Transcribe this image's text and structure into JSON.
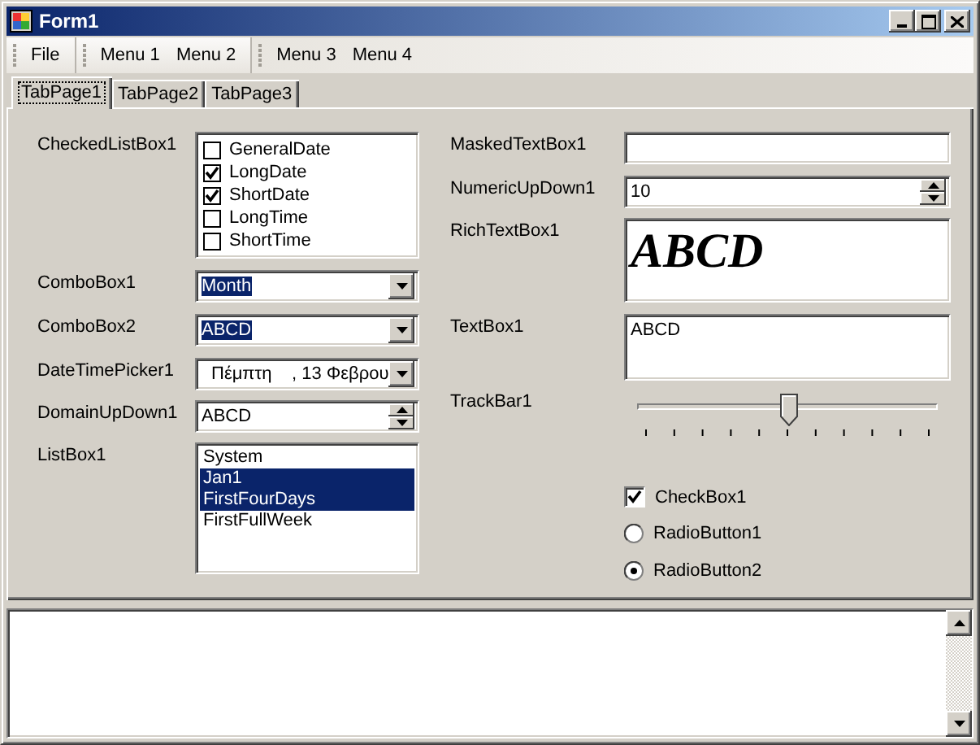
{
  "window": {
    "title": "Form1"
  },
  "menu_groups": [
    {
      "items": [
        "File"
      ]
    },
    {
      "items": [
        "Menu 1",
        "Menu 2"
      ]
    },
    {
      "items": [
        "Menu 3",
        "Menu 4"
      ]
    }
  ],
  "tabs": [
    {
      "label": "TabPage1",
      "selected": true
    },
    {
      "label": "TabPage2",
      "selected": false
    },
    {
      "label": "TabPage3",
      "selected": false
    }
  ],
  "left": [
    {
      "kind": "checkedlist",
      "label": "CheckedListBox1",
      "items": [
        {
          "text": "GeneralDate",
          "checked": false
        },
        {
          "text": "LongDate",
          "checked": true
        },
        {
          "text": "ShortDate",
          "checked": true
        },
        {
          "text": "LongTime",
          "checked": false
        },
        {
          "text": "ShortTime",
          "checked": false
        }
      ]
    },
    {
      "kind": "combo",
      "label": "ComboBox1",
      "value": "Month",
      "highlighted": true
    },
    {
      "kind": "combo",
      "label": "ComboBox2",
      "value": "ABCD",
      "highlighted": true
    },
    {
      "kind": "datetime",
      "label": "DateTimePicker1",
      "value": "Πέμπτη    , 13 Φεβρου"
    },
    {
      "kind": "updown",
      "label": "DomainUpDown1",
      "value": "ABCD"
    },
    {
      "kind": "listbox",
      "label": "ListBox1",
      "items": [
        {
          "text": "System",
          "selected": false
        },
        {
          "text": "Jan1",
          "selected": true
        },
        {
          "text": "FirstFourDays",
          "selected": true
        },
        {
          "text": "FirstFullWeek",
          "selected": false
        }
      ]
    }
  ],
  "right": [
    {
      "kind": "masked",
      "label": "MaskedTextBox1"
    },
    {
      "kind": "updown",
      "label": "NumericUpDown1",
      "value": "10"
    },
    {
      "kind": "rich",
      "label": "RichTextBox1",
      "value": "ABCD"
    },
    {
      "kind": "textbox",
      "label": "TextBox1",
      "value": "ABCD"
    },
    {
      "kind": "trackbar",
      "label": "TrackBar1",
      "level": 0.5
    },
    {
      "kind": "checkbox",
      "label": "CheckBox1",
      "checked": true
    },
    {
      "kind": "radio",
      "label": "RadioButton1",
      "selected": false
    },
    {
      "kind": "radio",
      "label": "RadioButton2",
      "selected": true
    }
  ]
}
